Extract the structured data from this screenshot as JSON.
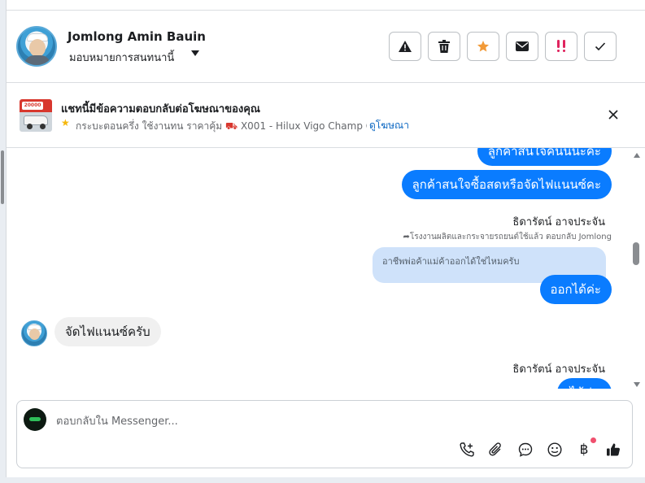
{
  "header": {
    "contact_name": "Jomlong Amin Bauin",
    "assign_label": "มอบหมายการสนทนานี้",
    "actions": [
      {
        "name": "report-spam-button",
        "icon": "warning-icon"
      },
      {
        "name": "delete-button",
        "icon": "trash-icon"
      },
      {
        "name": "star-button",
        "icon": "star-icon"
      },
      {
        "name": "mark-unread-button",
        "icon": "mail-icon"
      },
      {
        "name": "follow-up-button",
        "icon": "exclamation-icon"
      },
      {
        "name": "done-button",
        "icon": "checkmark-icon"
      }
    ],
    "colors": {
      "star": "#f29a38",
      "followup": "#e0245e"
    }
  },
  "ad_banner": {
    "title": "แชทนี้มีข้อความตอบกลับต่อโฆษณาของคุณ",
    "thumb_price": "20000",
    "description_prefix": "กระบะตอนครึ่ง ใช้งานทน ราคาคุ้ม",
    "description_suffix": "X001 - Hilux Vigo Champ Ca...",
    "link_label": "ดูโฆษณา"
  },
  "messages": {
    "out_partial_top": "ลูกค้าสนใจคันนี้นะคะ",
    "out_1": "ลูกค้าสนใจซื้อสดหรือจัดไฟแนนซ์คะ",
    "sender_1": "ธิดารัตน์ อาจประจัน",
    "reply_note": "โรงงานผลิตและกระจายรถยนต์ใช้แล้ว ตอบกลับ Jomlong",
    "quoted_text": "อาชีพพ่อค้าแม่ค้าออกได้ใช่ไหมครับ",
    "out_2": "ออกได้ค่ะ",
    "in_1": "จัดไฟแนนซ์ครับ",
    "sender_2": "ธิดารัตน์ อาจประจัน",
    "out_partial_bottom": "ได้ค่ะ"
  },
  "composer": {
    "placeholder": "ตอบกลับใน Messenger...",
    "value": "",
    "icons": [
      "add-call-icon",
      "attachment-icon",
      "saved-replies-icon",
      "emoji-icon",
      "payment-baht-icon",
      "like-icon"
    ],
    "baht_symbol": "฿",
    "notification_color": "#f0506e"
  },
  "accent_color": "#0a7cff"
}
